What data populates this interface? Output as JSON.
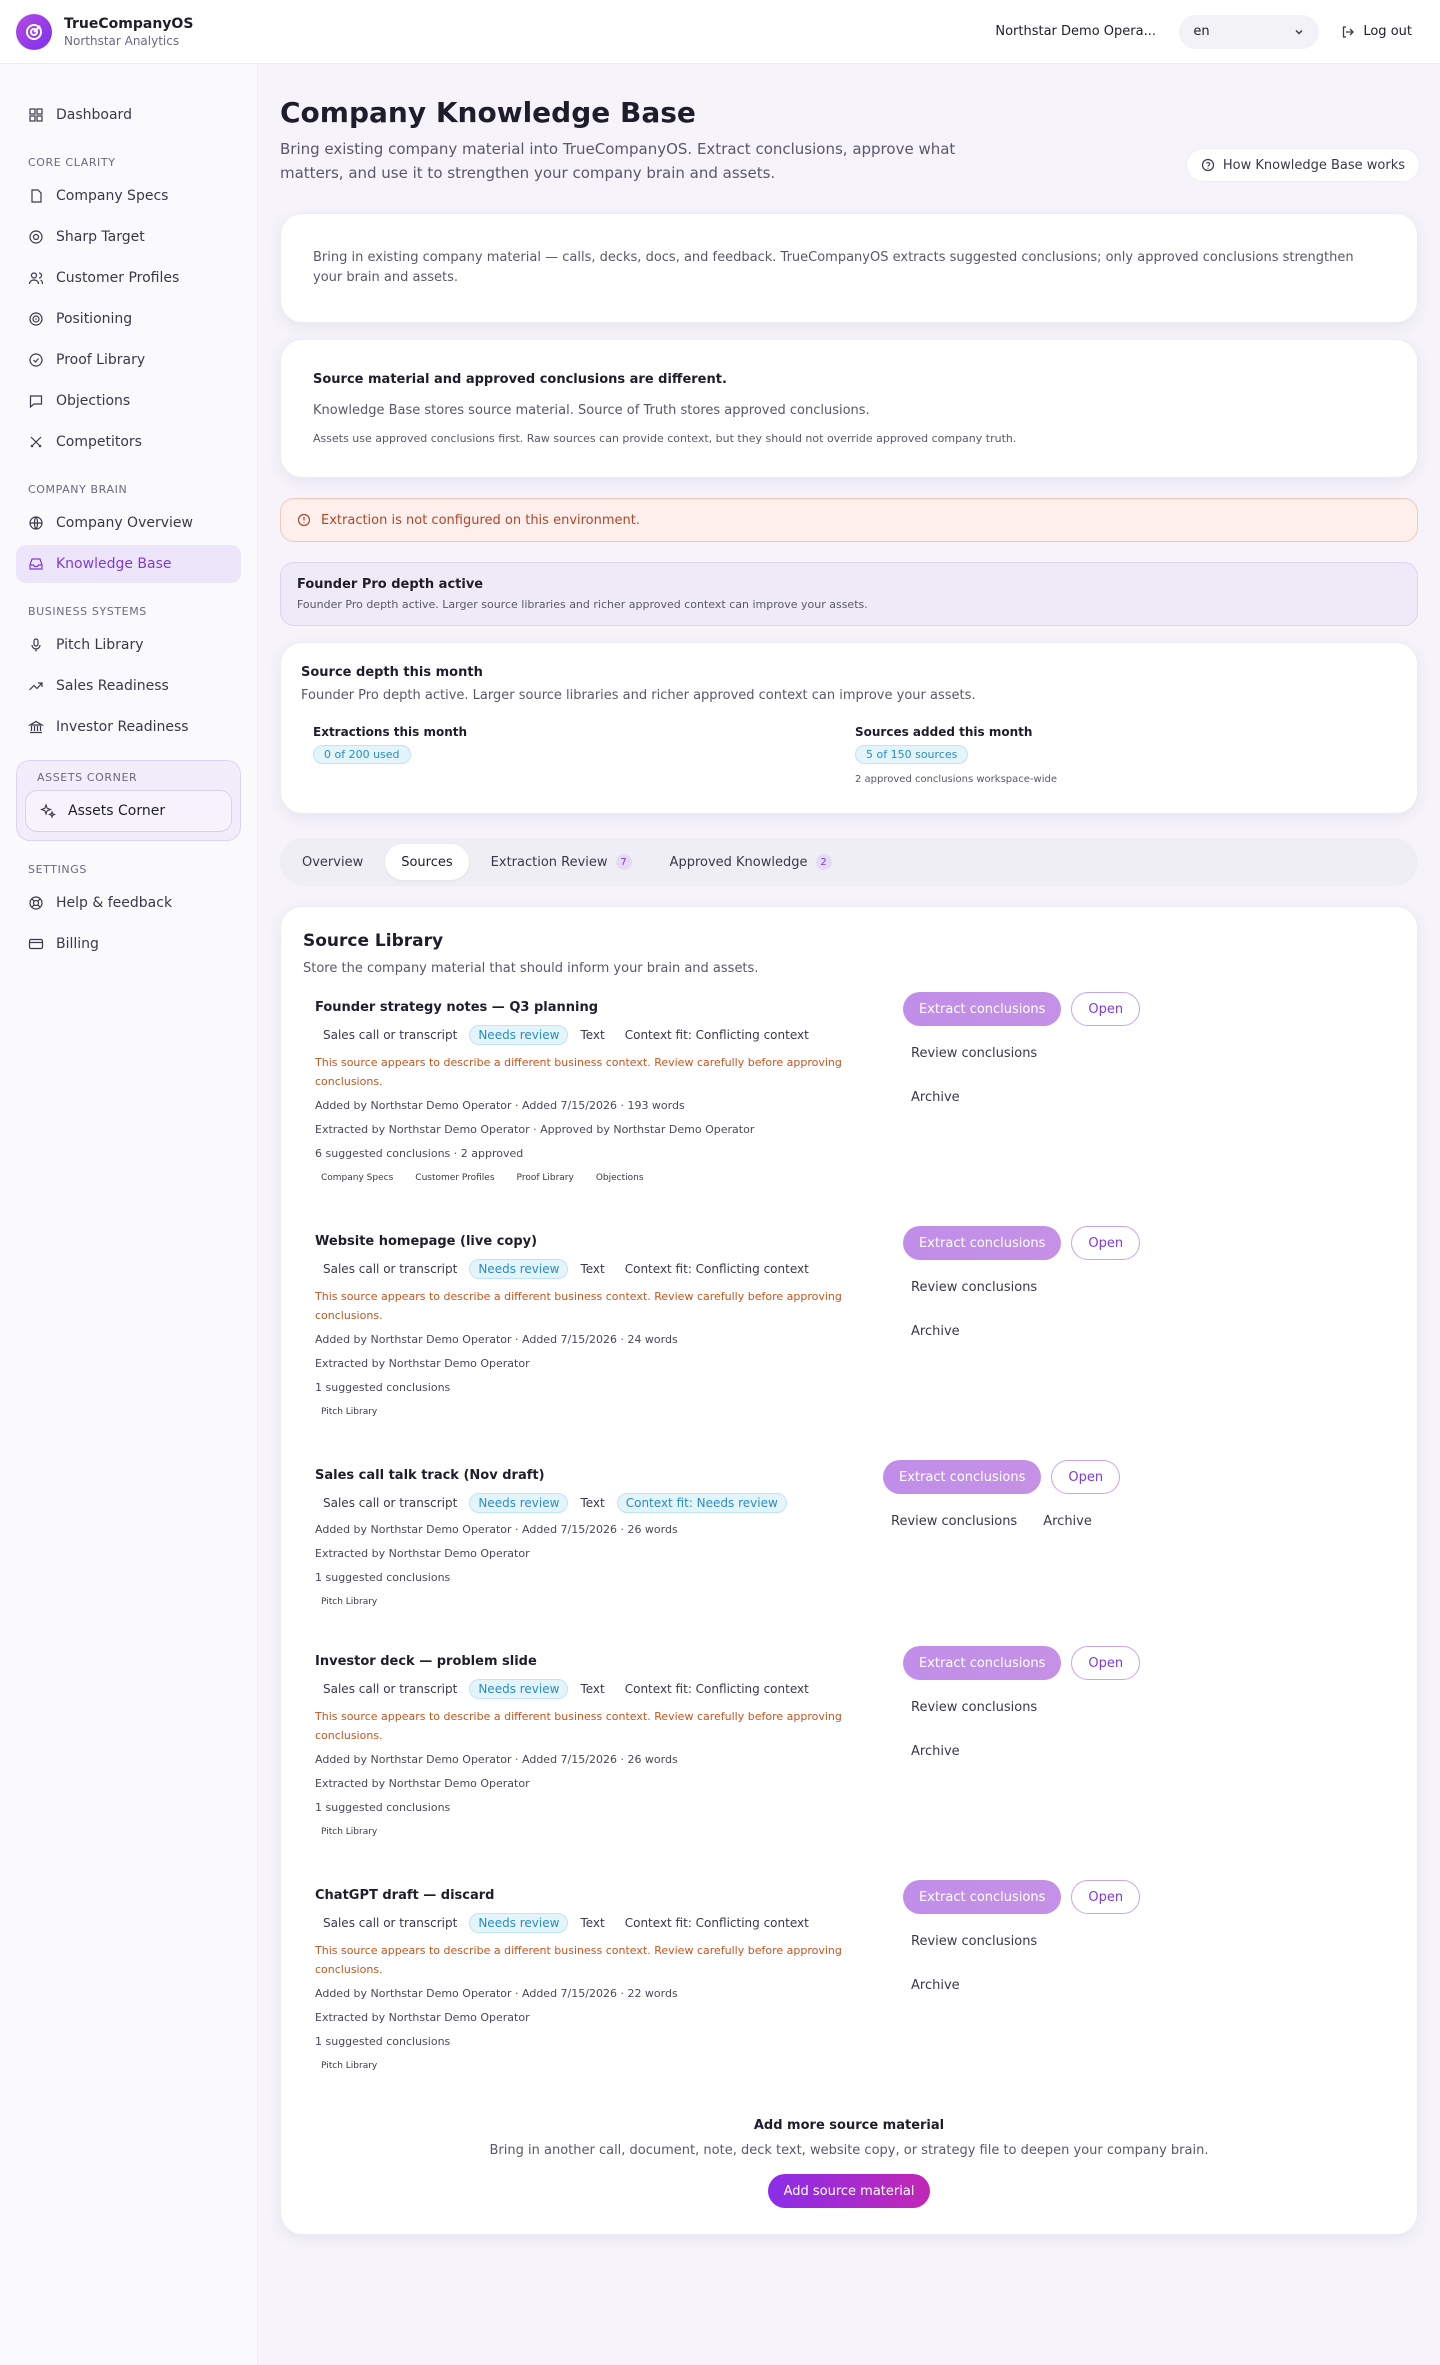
{
  "brand": {
    "name": "TrueCompanyOS",
    "sub": "Northstar Analytics"
  },
  "header": {
    "workspace": "Northstar Demo Opera...",
    "language": "en",
    "logout": "Log out"
  },
  "sidebar": {
    "dashboard": "Dashboard",
    "sections": [
      {
        "title": "CORE CLARITY",
        "items": [
          "Company Specs",
          "Sharp Target",
          "Customer Profiles",
          "Positioning",
          "Proof Library",
          "Objections",
          "Competitors"
        ]
      },
      {
        "title": "COMPANY BRAIN",
        "items": [
          "Company Overview",
          "Knowledge Base"
        ]
      },
      {
        "title": "BUSINESS SYSTEMS",
        "items": [
          "Pitch Library",
          "Sales Readiness",
          "Investor Readiness"
        ]
      }
    ],
    "assets_title": "ASSETS CORNER",
    "assets_button": "Assets Corner",
    "settings_title": "SETTINGS",
    "settings_items": [
      "Help & feedback",
      "Billing"
    ]
  },
  "page": {
    "title": "Company Knowledge Base",
    "subtitle": "Bring existing company material into TrueCompanyOS. Extract conclusions, approve what matters, and use it to strengthen your company brain and assets.",
    "how_button": "How Knowledge Base works"
  },
  "intro": "Bring in existing company material — calls, decks, docs, and feedback. TrueCompanyOS extracts suggested conclusions; only approved conclusions strengthen your brain and assets.",
  "truth": {
    "title": "Source material and approved conclusions are different.",
    "p1": "Knowledge Base stores source material. Source of Truth stores approved conclusions.",
    "p2": "Assets use approved conclusions first. Raw sources can provide context, but they should not override approved company truth."
  },
  "alert": "Extraction is not configured on this environment.",
  "pro": {
    "title": "Founder Pro depth active",
    "desc": "Founder Pro depth active. Larger source libraries and richer approved context can improve your assets."
  },
  "depth": {
    "title": "Source depth this month",
    "desc": "Founder Pro depth active. Larger source libraries and richer approved context can improve your assets.",
    "extractions_label": "Extractions this month",
    "extractions_value": "0 of 200 used",
    "sources_label": "Sources added this month",
    "sources_value": "5 of 150 sources",
    "sources_note": "2 approved conclusions workspace-wide"
  },
  "tabs": [
    {
      "label": "Overview",
      "count": ""
    },
    {
      "label": "Sources",
      "count": ""
    },
    {
      "label": "Extraction Review",
      "count": "7"
    },
    {
      "label": "Approved Knowledge",
      "count": "2"
    }
  ],
  "library": {
    "title": "Source Library",
    "desc": "Store the company material that should inform your brain and assets.",
    "actions": {
      "extract": "Extract conclusions",
      "open": "Open",
      "review": "Review conclusions",
      "archive": "Archive"
    },
    "sources": [
      {
        "title": "Founder strategy notes — Q3 planning",
        "type": "Sales call or transcript",
        "status": "Needs review",
        "format": "Text",
        "fit": "Context fit: Conflicting context",
        "warning": "This source appears to describe a different business context. Review carefully before approving conclusions.",
        "added": "Added by Northstar Demo Operator · Added 7/15/2026 · 193 words",
        "extracted": "Extracted by Northstar Demo Operator · Approved by Northstar Demo Operator",
        "suggested": "6 suggested conclusions · 2 approved",
        "chips": [
          "Company Specs",
          "Customer Profiles",
          "Proof Library",
          "Objections"
        ]
      },
      {
        "title": "Website homepage (live copy)",
        "type": "Sales call or transcript",
        "status": "Needs review",
        "format": "Text",
        "fit": "Context fit: Conflicting context",
        "warning": "This source appears to describe a different business context. Review carefully before approving conclusions.",
        "added": "Added by Northstar Demo Operator · Added 7/15/2026 · 24 words",
        "extracted": "Extracted by Northstar Demo Operator",
        "suggested": "1 suggested conclusions",
        "chips": [
          "Pitch Library"
        ]
      },
      {
        "title": "Sales call talk track (Nov draft)",
        "type": "Sales call or transcript",
        "status": "Needs review",
        "format": "Text",
        "fit": "Context fit: Needs review",
        "warning": "",
        "added": "Added by Northstar Demo Operator · Added 7/15/2026 · 26 words",
        "extracted": "Extracted by Northstar Demo Operator",
        "suggested": "1 suggested conclusions",
        "chips": [
          "Pitch Library"
        ]
      },
      {
        "title": "Investor deck — problem slide",
        "type": "Sales call or transcript",
        "status": "Needs review",
        "format": "Text",
        "fit": "Context fit: Conflicting context",
        "warning": "This source appears to describe a different business context. Review carefully before approving conclusions.",
        "added": "Added by Northstar Demo Operator · Added 7/15/2026 · 26 words",
        "extracted": "Extracted by Northstar Demo Operator",
        "suggested": "1 suggested conclusions",
        "chips": [
          "Pitch Library"
        ]
      },
      {
        "title": "ChatGPT draft — discard",
        "type": "Sales call or transcript",
        "status": "Needs review",
        "format": "Text",
        "fit": "Context fit: Conflicting context",
        "warning": "This source appears to describe a different business context. Review carefully before approving conclusions.",
        "added": "Added by Northstar Demo Operator · Added 7/15/2026 · 22 words",
        "extracted": "Extracted by Northstar Demo Operator",
        "suggested": "1 suggested conclusions",
        "chips": [
          "Pitch Library"
        ]
      }
    ],
    "add_title": "Add more source material",
    "add_desc": "Bring in another call, document, note, deck text, website copy, or strategy file to deepen your company brain.",
    "add_button": "Add source material"
  },
  "colors": {
    "accent": "#7e3ad9",
    "alert": "#b2442a",
    "warning": "#c4551d",
    "badge": "#2b8dbd"
  }
}
